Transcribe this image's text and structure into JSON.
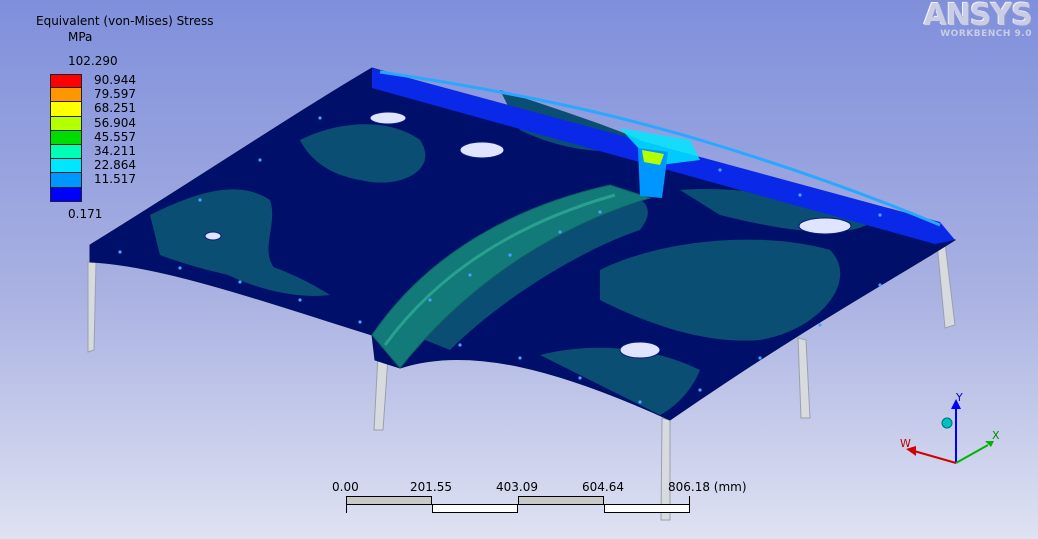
{
  "legend": {
    "title": "Equivalent (von-Mises) Stress",
    "unit": "MPa",
    "max": "102.290",
    "min": "0.171",
    "levels": [
      "90.944",
      "79.597",
      "68.251",
      "56.904",
      "45.557",
      "34.211",
      "22.864",
      "11.517"
    ],
    "colors": [
      "#ff0000",
      "#ff9600",
      "#ffff00",
      "#b4ff00",
      "#00dc00",
      "#00ffb4",
      "#00e6ff",
      "#0096ff",
      "#0000ff"
    ]
  },
  "logo": {
    "name": "ANSYS",
    "subtitle": "WORKBENCH 9.0"
  },
  "scale": {
    "ticks": [
      "0.00",
      "201.55",
      "403.09",
      "604.64",
      "806.18 (mm)"
    ]
  },
  "triad": {
    "x": "X",
    "y": "Y",
    "w": "W"
  },
  "colors": {
    "plate_base": "#00106a",
    "plate_mid": "#0b4e73",
    "plate_light": "#1a7a7a",
    "edge_blue": "#0a28e8",
    "leg_color": "#d7dbe0"
  }
}
